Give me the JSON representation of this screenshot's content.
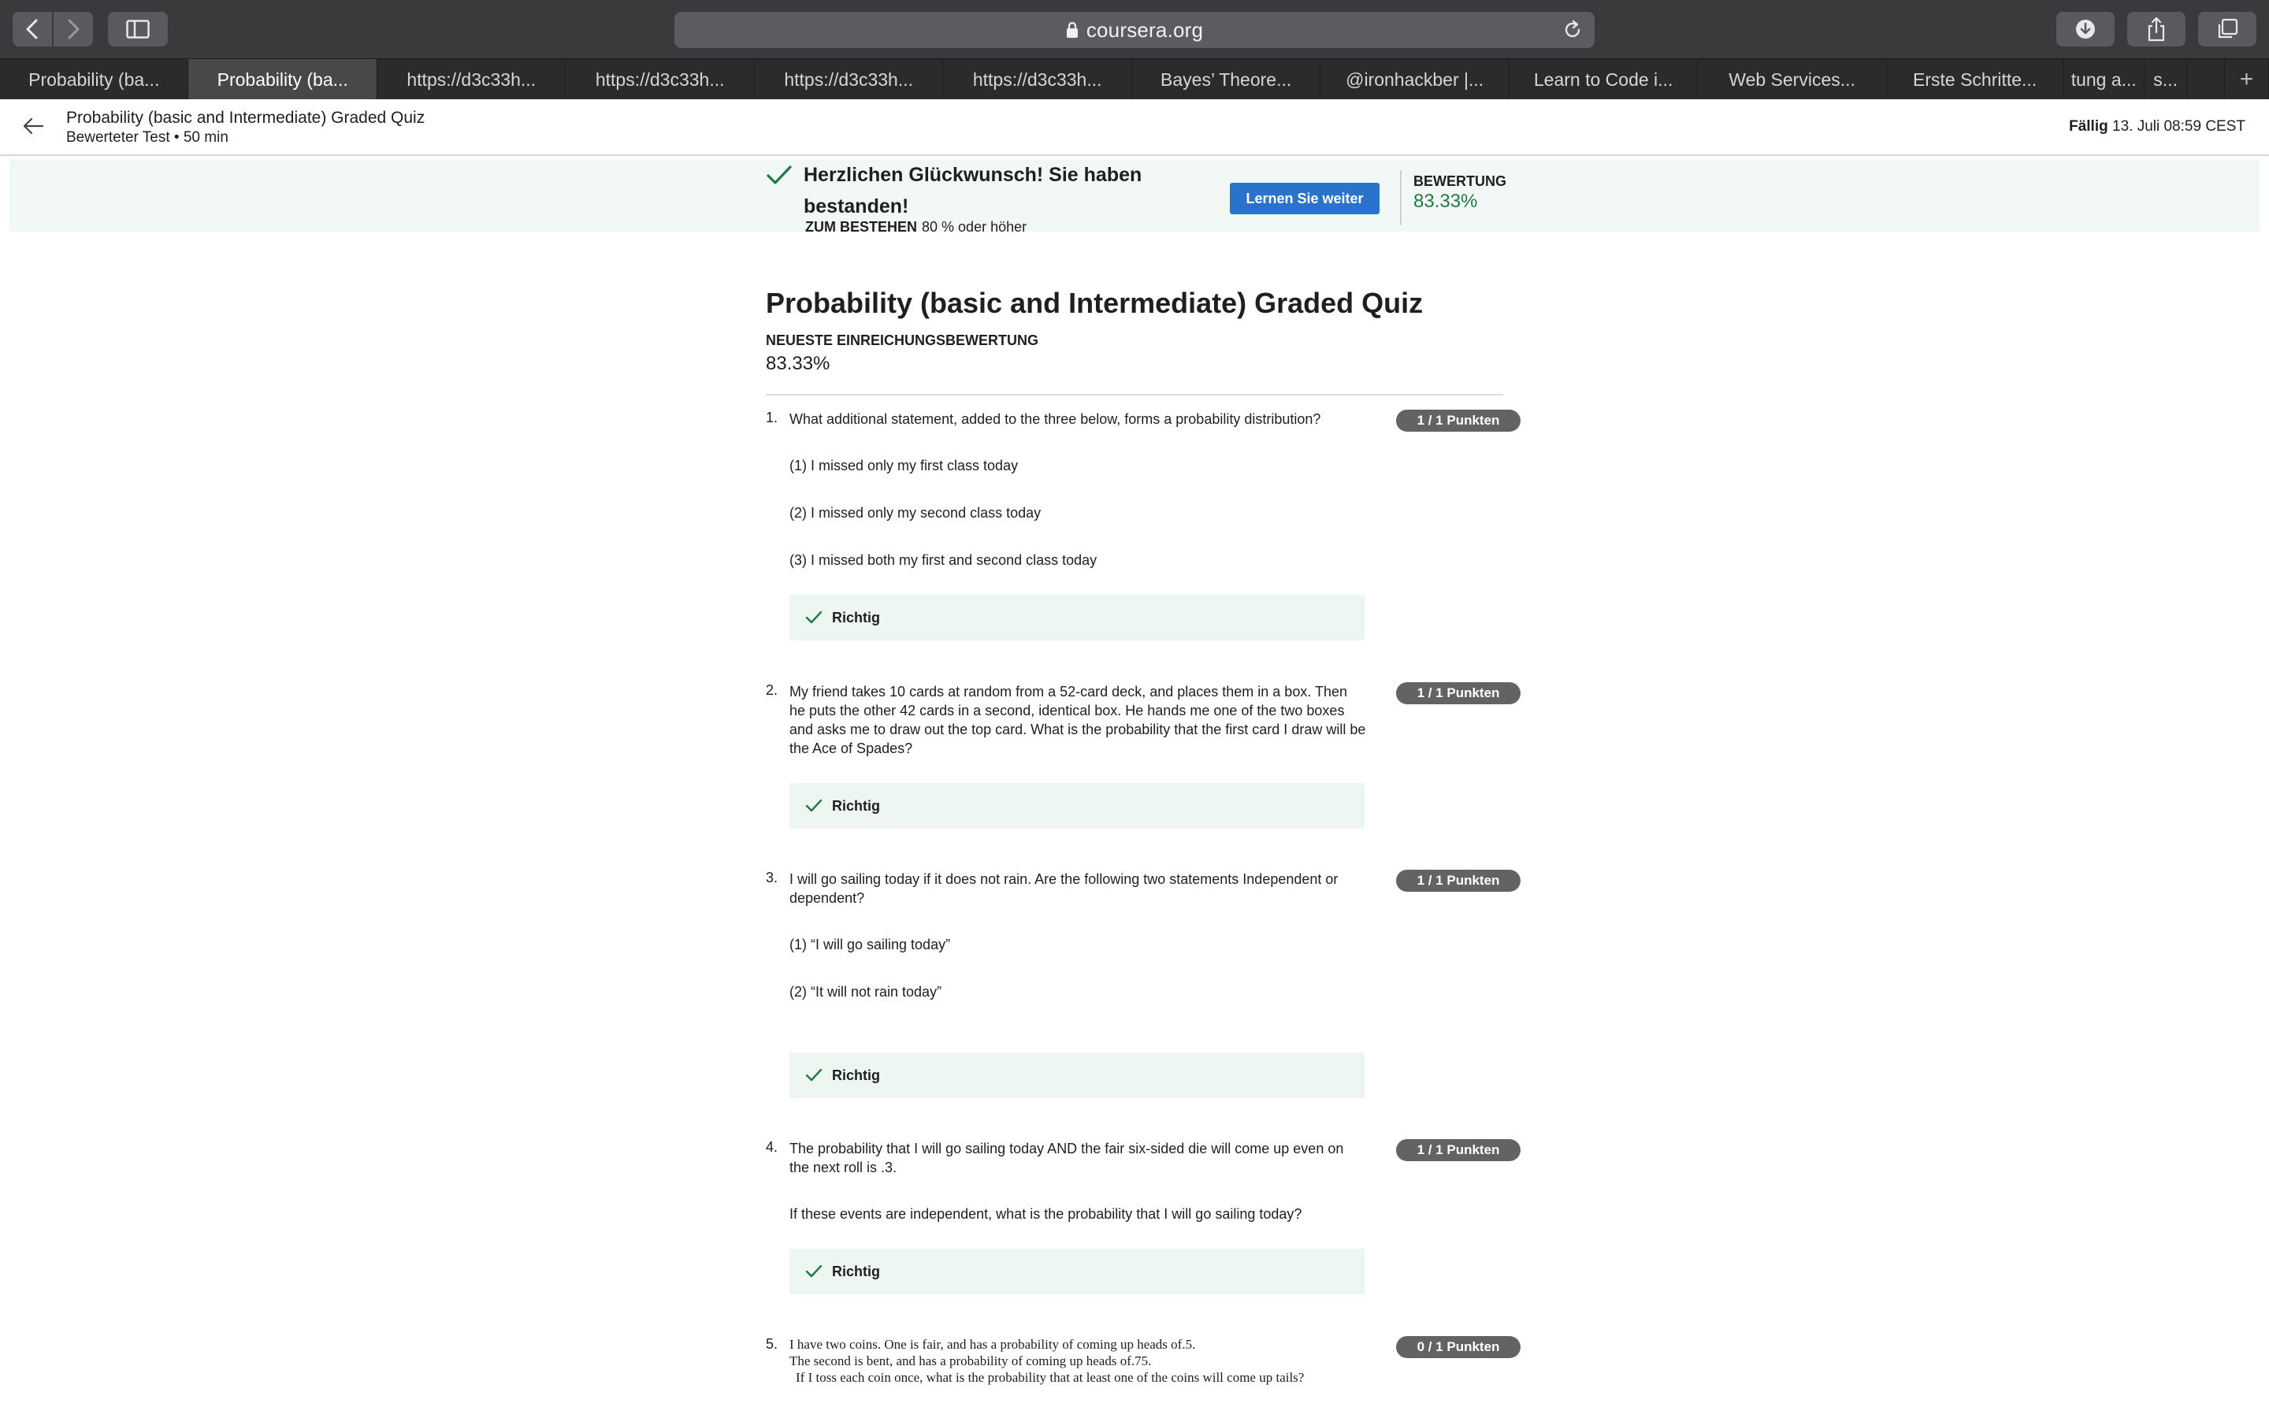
{
  "browser": {
    "address": "coursera.org",
    "tabs": [
      {
        "label": "Probability (ba..."
      },
      {
        "label": "Probability (ba..."
      },
      {
        "label": "https://d3c33h..."
      },
      {
        "label": "https://d3c33h..."
      },
      {
        "label": "https://d3c33h..."
      },
      {
        "label": "https://d3c33h..."
      },
      {
        "label": "Bayes’ Theore..."
      },
      {
        "label": "@ironhackber |..."
      },
      {
        "label": "Learn to Code i..."
      },
      {
        "label": "Web Services..."
      },
      {
        "label": "Erste Schritte..."
      },
      {
        "label": "tung a..."
      },
      {
        "label": "s..."
      },
      {
        "label": ""
      },
      {
        "label": "+"
      }
    ]
  },
  "header": {
    "title": "Probability (basic and Intermediate) Graded Quiz",
    "subtitle": "Bewerteter Test • 50 min",
    "due_label": "Fällig",
    "due_value": "13. Juli 08:59 CEST"
  },
  "banner": {
    "title": "Herzlichen Glückwunsch! Sie haben bestanden!",
    "pass_label": "ZUM BESTEHEN",
    "pass_value": "80 % oder höher",
    "continue_label": "Lernen Sie weiter",
    "grade_label": "BEWERTUNG",
    "grade_value": "83.33%",
    "accent_color": "#1f7a43",
    "button_color": "#2a73cc"
  },
  "quiz": {
    "title": "Probability (basic and Intermediate) Graded Quiz",
    "latest_label": "NEUESTE EINREICHUNGSBEWERTUNG",
    "latest_value": "83.33%",
    "questions": [
      {
        "number": "1.",
        "text": "What additional statement, added to the three below, forms a probability distribution?",
        "items": [
          "(1) I missed only my first class today",
          "(2) I missed only my second class today",
          "(3) I missed both my first and second class today"
        ],
        "points": "1 / 1 Punkten",
        "result": "Richtig"
      },
      {
        "number": "2.",
        "text": "My friend takes 10 cards at random from a 52-card deck, and places them in a box. Then he puts the other 42 cards in a second, identical box. He hands me one of the two boxes and asks me to draw out the top card. What is the probability that the first card I draw will be the Ace of Spades?",
        "items": [],
        "points": "1 / 1 Punkten",
        "result": "Richtig"
      },
      {
        "number": "3.",
        "text": "I will go sailing today if it does not rain. Are the following two statements Independent or dependent?",
        "items": [
          "(1) “I will go sailing today”",
          "(2) “It will not rain today”"
        ],
        "points": "1 / 1 Punkten",
        "result": "Richtig"
      },
      {
        "number": "4.",
        "text": "The probability that I will go sailing today AND the fair six-sided die will come up even on the next roll is .3.",
        "items": [
          "If these events are independent, what is the probability that I will go sailing today?"
        ],
        "points": "1 / 1 Punkten",
        "result": "Richtig"
      },
      {
        "number": "5.",
        "text": "I have two coins. One is fair, and has a probability of coming up heads of.5.",
        "lines": [
          "The second is bent, and has a probability of coming up heads of.75.",
          "If I toss each coin once, what is the probability that at least one of the coins will come up tails?"
        ],
        "points": "0 / 1 Punkten"
      }
    ]
  }
}
